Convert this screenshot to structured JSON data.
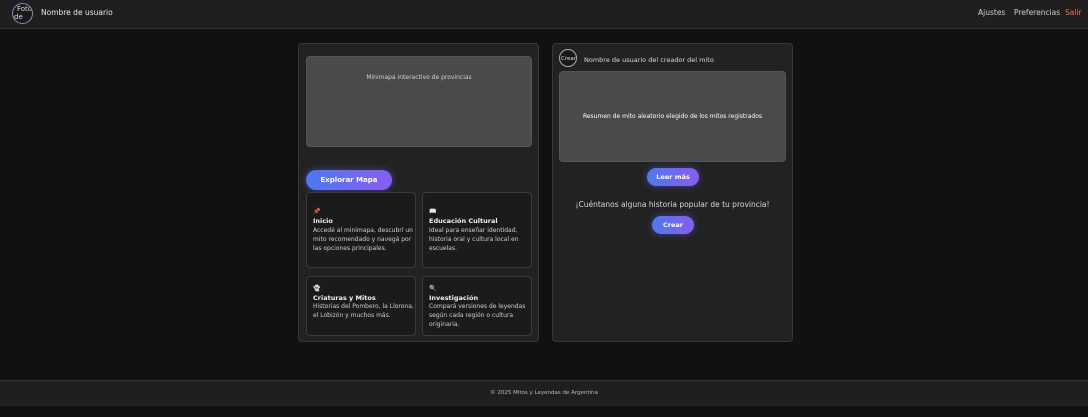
{
  "header": {
    "avatar_alt": "Foto de",
    "avatar_line1": "Foto",
    "avatar_line2": "de",
    "username": "Nombre de usuario",
    "nav": [
      "Ajustes",
      "Preferencias",
      "Salir"
    ]
  },
  "left_panel": {
    "minimap_label": "Minimapa interactivo de provincias",
    "explore_button": "Explorar Mapa",
    "cards": [
      {
        "icon": "📌",
        "title": "Inicio",
        "description": "Accedé al minimapa, descubrí un mito recomendado y navegá por las opciones principales."
      },
      {
        "icon": "📖",
        "title": "Educación Cultural",
        "description": "Ideal para enseñar identidad, historia oral y cultura local en escuelas."
      },
      {
        "icon": "👻",
        "title": "Criaturas y Mitos",
        "description": "Historias del Pombero, la Llorona, el Lobizón y muchos más."
      },
      {
        "icon": "🔍",
        "title": "Investigación",
        "description": "Compará versiones de leyendas según cada región o cultura originaria."
      }
    ]
  },
  "right_panel": {
    "creator_avatar_text": "Crear",
    "creator_name": "Nombre de usuario del creador del mito",
    "summary": "Resumen de mito aleatorio elegido de los mitos registrados",
    "read_more_button": "Leer más",
    "prompt": "¡Cuéntanos alguna historia popular de tu provincia!",
    "create_button": "Crear"
  },
  "footer": {
    "text": "© 2025 Mitos y Leyendas de Argentina"
  },
  "colors": {
    "accent_start": "#4b79f0",
    "accent_end": "#8a5cf5",
    "exit": "#ff6b6b",
    "background": "#111111"
  }
}
